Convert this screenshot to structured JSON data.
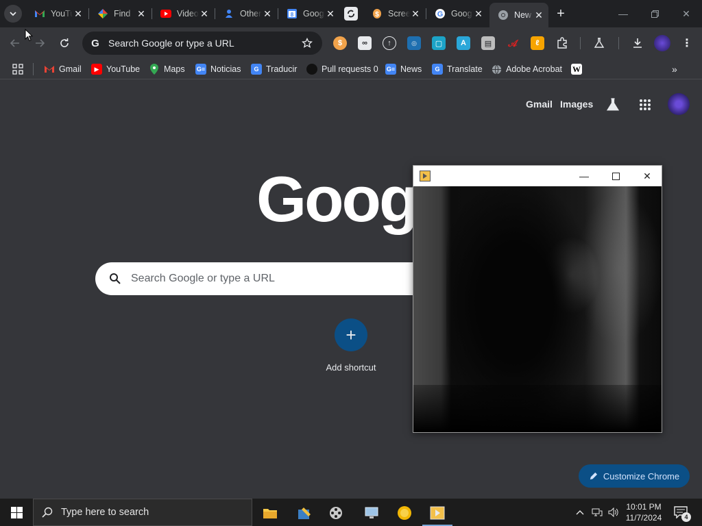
{
  "tabs": [
    {
      "title": "YouTube",
      "favicon": "gmail-icon",
      "active": false
    },
    {
      "title": "Find",
      "favicon": "chrome-store-icon",
      "active": false
    },
    {
      "title": "Video",
      "favicon": "youtube-icon",
      "active": false
    },
    {
      "title": "Other",
      "favicon": "drive-people-icon",
      "active": false
    },
    {
      "title": "Google",
      "favicon": "google-calendar-icon",
      "active": false
    },
    {
      "title": "",
      "favicon": "sync-icon",
      "active": false
    },
    {
      "title": "Screen",
      "favicon": "bitcoin-icon",
      "active": false
    },
    {
      "title": "Google",
      "favicon": "google-icon",
      "active": false
    },
    {
      "title": "New Tab",
      "favicon": "chrome-icon",
      "active": true
    }
  ],
  "toolbar": {
    "omnibox_placeholder": "Search Google or type a URL"
  },
  "bookmarks": [
    {
      "label": "Gmail",
      "icon": "gmail-icon",
      "color": "#ea4335"
    },
    {
      "label": "YouTube",
      "icon": "youtube-icon",
      "color": "#ff0000"
    },
    {
      "label": "Maps",
      "icon": "maps-pin-icon",
      "color": "#34a853"
    },
    {
      "label": "Noticias",
      "icon": "news-icon",
      "color": "#4285f4"
    },
    {
      "label": "Traducir",
      "icon": "translate-icon",
      "color": "#4285f4"
    },
    {
      "label": "Pull requests 0",
      "icon": "github-icon",
      "color": "#000000"
    },
    {
      "label": "News",
      "icon": "news-icon",
      "color": "#4285f4"
    },
    {
      "label": "Translate",
      "icon": "translate-icon",
      "color": "#4285f4"
    },
    {
      "label": "Adobe Acrobat",
      "icon": "globe-icon",
      "color": "#9aa0a6"
    },
    {
      "label": "",
      "icon": "wikipedia-icon",
      "color": "#ffffff"
    }
  ],
  "ntp": {
    "gmail_link": "Gmail",
    "images_link": "Images",
    "logo_text": "Google",
    "search_placeholder": "Search Google or type a URL",
    "shortcut_label": "Add shortcut",
    "customize_label": "Customize Chrome"
  },
  "taskbar": {
    "search_placeholder": "Type here to search",
    "time": "10:01 PM",
    "date": "11/7/2024",
    "notification_count": "4"
  },
  "colors": {
    "accent": "#0b4f86",
    "page_bg": "#35363a",
    "tabstrip_bg": "#202124"
  }
}
